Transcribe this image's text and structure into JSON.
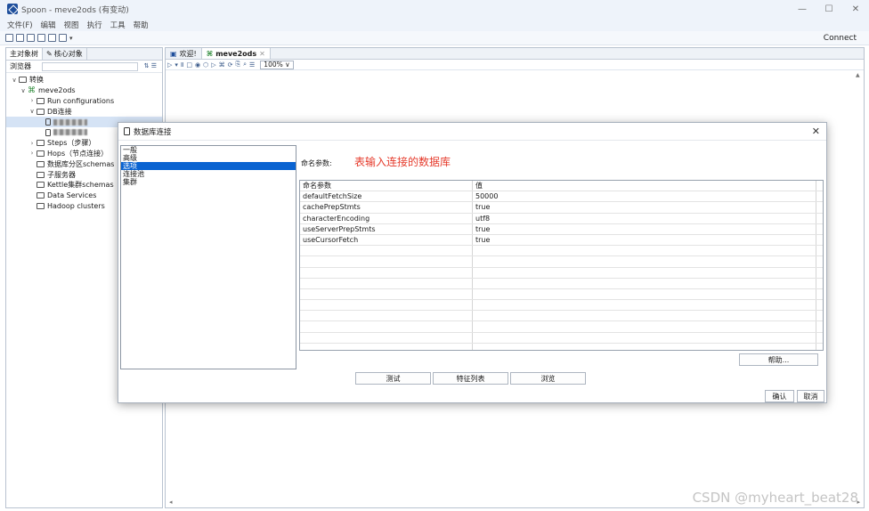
{
  "window": {
    "title": "Spoon - meve2ods (有变动)",
    "controls": [
      "—",
      "☐",
      "✕"
    ]
  },
  "menu": [
    "文件(F)",
    "编辑",
    "视图",
    "执行",
    "工具",
    "帮助"
  ],
  "toolbar": {
    "connect_label": "Connect"
  },
  "left_panel": {
    "tabs": [
      "主对象树",
      "核心对象"
    ],
    "browser_label": "浏览器",
    "tree": [
      {
        "label": "转换",
        "level": 0,
        "twisty": "∨",
        "icon": "folder"
      },
      {
        "label": "meve2ods",
        "level": 1,
        "twisty": "∨",
        "icon": "transformation"
      },
      {
        "label": "Run configurations",
        "level": 2,
        "twisty": "›",
        "icon": "folder"
      },
      {
        "label": "DB连接",
        "level": 2,
        "twisty": "∨",
        "icon": "folder"
      },
      {
        "label": "",
        "level": 3,
        "twisty": "",
        "icon": "database",
        "redacted": true
      },
      {
        "label": "",
        "level": 3,
        "twisty": "",
        "icon": "database",
        "redacted": true
      },
      {
        "label": "Steps（步骤）",
        "level": 2,
        "twisty": "›",
        "icon": "folder"
      },
      {
        "label": "Hops（节点连接）",
        "level": 2,
        "twisty": "›",
        "icon": "folder"
      },
      {
        "label": "数据库分区schemas",
        "level": 2,
        "twisty": "",
        "icon": "folder"
      },
      {
        "label": "子服务器",
        "level": 2,
        "twisty": "",
        "icon": "folder"
      },
      {
        "label": "Kettle集群schemas",
        "level": 2,
        "twisty": "",
        "icon": "folder"
      },
      {
        "label": "Data Services",
        "level": 2,
        "twisty": "",
        "icon": "folder"
      },
      {
        "label": "Hadoop clusters",
        "level": 2,
        "twisty": "",
        "icon": "folder"
      }
    ]
  },
  "editor": {
    "tabs": [
      {
        "label": "欢迎!",
        "active": false
      },
      {
        "label": "meve2ods",
        "active": true
      }
    ],
    "zoom": "100%"
  },
  "dialog": {
    "title": "数据库连接",
    "categories": [
      "一般",
      "高级",
      "选项",
      "连接池",
      "集群"
    ],
    "selected_category": "选项",
    "param_label": "命名参数:",
    "note": "表输入连接的数据库",
    "table": {
      "headers": [
        "命名参数",
        "值"
      ],
      "rows": [
        [
          "defaultFetchSize",
          "50000"
        ],
        [
          "cachePrepStmts",
          "true"
        ],
        [
          "characterEncoding",
          "utf8"
        ],
        [
          "useServerPrepStmts",
          "true"
        ],
        [
          "useCursorFetch",
          "true"
        ]
      ]
    },
    "help_button": "帮助...",
    "bottom_buttons": [
      "测试",
      "特征列表",
      "浏览"
    ],
    "ok_button": "确认",
    "cancel_button": "取消"
  },
  "watermark": "CSDN @myheart_beat28"
}
